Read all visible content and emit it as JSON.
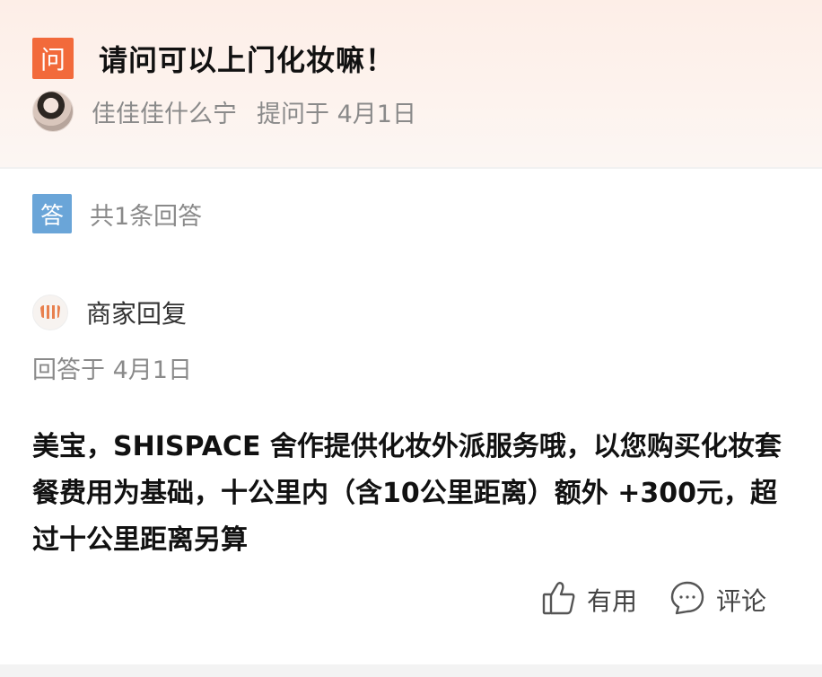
{
  "question": {
    "badge": "问",
    "title": "请问可以上门化妆嘛！",
    "asker_name": "佳佳佳什么宁",
    "asked_date": "提问于 4月1日"
  },
  "answers": {
    "badge": "答",
    "count_text": "共1条回答"
  },
  "answer": {
    "merchant_label": "商家回复",
    "date": "回答于 4月1日",
    "text": "美宝，SHISPACE 舍作提供化妆外派服务哦，以您购买化妆套餐费用为基础，十公里内（含10公里距离）额外 +300元，超过十公里距离另算"
  },
  "actions": {
    "useful_label": "有用",
    "comment_label": "评论"
  },
  "colors": {
    "question_badge": "#f26a3b",
    "answer_badge": "#6aa5d8",
    "muted_text": "#8a8a8a"
  },
  "icons": {
    "question_badge": "question-badge-icon",
    "answer_badge": "answer-badge-icon",
    "merchant": "shop-awning-icon",
    "useful": "thumbs-up-icon",
    "comment": "comment-bubble-icon"
  }
}
